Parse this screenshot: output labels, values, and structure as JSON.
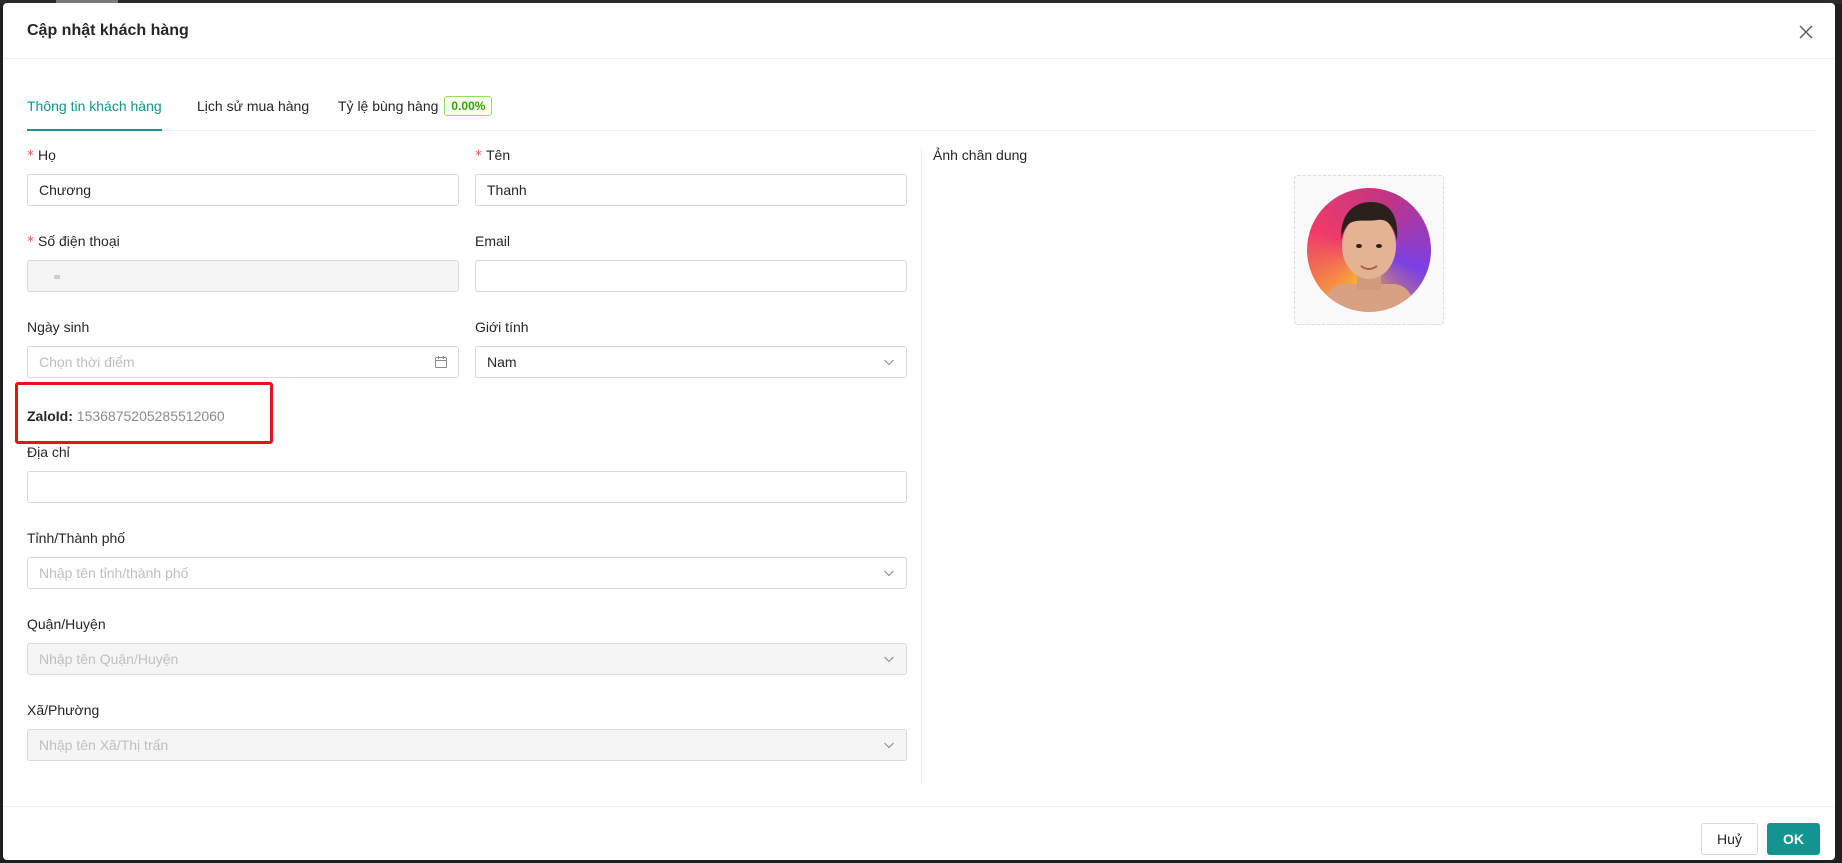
{
  "modal": {
    "title": "Cập nhật khách hàng"
  },
  "tabs": [
    {
      "label": "Thông tin khách hàng",
      "active": true
    },
    {
      "label": "Lịch sử mua hàng",
      "active": false
    },
    {
      "label": "Tỷ lệ bùng hàng",
      "active": false,
      "badge": "0.00%"
    }
  ],
  "form": {
    "last_name": {
      "label": "Họ",
      "required": true,
      "value": "Chương"
    },
    "first_name": {
      "label": "Tên",
      "required": true,
      "value": "Thanh"
    },
    "phone": {
      "label": "Số điện thoại",
      "required": true,
      "value": "",
      "disabled": true
    },
    "email": {
      "label": "Email",
      "value": ""
    },
    "birthday": {
      "label": "Ngày sinh",
      "placeholder": "Chọn thời điểm",
      "icon": "calendar-icon"
    },
    "gender": {
      "label": "Giới tính",
      "value": "Nam",
      "icon": "chevron-down-icon"
    },
    "zalo": {
      "key": "ZaloId:",
      "value": "1536875205285512060"
    },
    "address": {
      "label": "Địa chỉ",
      "value": ""
    },
    "province": {
      "label": "Tỉnh/Thành phố",
      "placeholder": "Nhập tên tỉnh/thành phố"
    },
    "district": {
      "label": "Quận/Huyện",
      "placeholder": "Nhập tên Quận/Huyện",
      "disabled": true
    },
    "ward": {
      "label": "Xã/Phường",
      "placeholder": "Nhập tên Xã/Thị trấn",
      "disabled": true
    }
  },
  "portrait": {
    "label": "Ảnh chân dung"
  },
  "footer": {
    "cancel_label": "Huỷ",
    "ok_label": "OK"
  },
  "colors": {
    "accent": "#12948f",
    "required": "#ff4d4f",
    "highlight": "#e0161b",
    "badge_text": "#389e0d"
  }
}
